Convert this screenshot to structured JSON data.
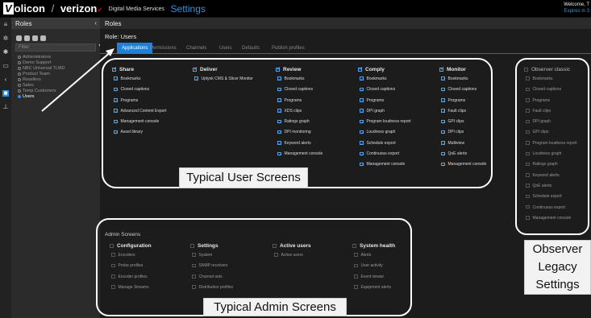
{
  "topbar": {
    "logo_prefix": "V",
    "logo_rest": "olicon",
    "partner": "verizon",
    "partner_mark": "✓",
    "dms": "Digital Media Services",
    "section": "Settings",
    "welcome": "Welcome, T",
    "expires": "Expires in 3"
  },
  "sidebar_icons": [
    "menu-icon",
    "gear-icon",
    "wrench-icon",
    "monitor-icon",
    "share-icon",
    "active-square-icon",
    "user-icon"
  ],
  "left_panel": {
    "title": "Roles",
    "collapse": "‹",
    "filter_placeholder": "Filter",
    "filter_icon": "▼",
    "items": [
      {
        "label": "Administrators",
        "selected": false
      },
      {
        "label": "Demo Support",
        "selected": false
      },
      {
        "label": "NBC Universal TLMD",
        "selected": false
      },
      {
        "label": "Product Team",
        "selected": false
      },
      {
        "label": "Resellers",
        "selected": false
      },
      {
        "label": "Sales",
        "selected": false
      },
      {
        "label": "Temp Customers",
        "selected": false
      },
      {
        "label": "Users",
        "selected": true
      }
    ]
  },
  "main": {
    "header": "Roles",
    "role_title": "Role: Users",
    "tabs": [
      "Applications",
      "Permissions",
      "Channels",
      "Users",
      "Defaults",
      "Publish profiles"
    ],
    "active_tab": 0
  },
  "user_columns": [
    {
      "title": "Share",
      "checked": true,
      "items": [
        "Bookmarks",
        "Closed captions",
        "Programs",
        "Advanced Content Export",
        "Management console",
        "Asset library"
      ]
    },
    {
      "title": "Deliver",
      "checked": true,
      "items": [
        "Uplynk CMS & Slicer Monitor"
      ]
    },
    {
      "title": "Review",
      "checked": true,
      "items": [
        "Bookmarks",
        "Closed captions",
        "Programs",
        "XDS clips",
        "Ratings graph",
        "DPI monitoring",
        "Keyword alerts",
        "Management console"
      ]
    },
    {
      "title": "Comply",
      "checked": true,
      "items": [
        "Bookmarks",
        "Closed captions",
        "Programs",
        "DPI graph",
        "Program loudness report",
        "Loudness graph",
        "Schedule export",
        "Continuous export",
        "Management console"
      ]
    },
    {
      "title": "Monitor",
      "checked": true,
      "items": [
        "Bookmarks",
        "Closed captions",
        "Programs",
        "Fault clips",
        "GPI clips",
        "DPI clips",
        "Multiview",
        "QoE alerts",
        "Management console"
      ]
    }
  ],
  "observer": {
    "title": "Observer classic",
    "items": [
      "Bookmarks",
      "Closed captions",
      "Programs",
      "Fault clips",
      "DPI graph",
      "GPI clips",
      "Program loudness report",
      "Loudness graph",
      "Ratings graph",
      "Keyword alerts",
      "QoE alerts",
      "Schedule export",
      "Continuous export",
      "Management console"
    ]
  },
  "admin": {
    "title": "Admin Screens",
    "columns": [
      {
        "title": "Configuration",
        "items": [
          "Encoders",
          "Probe profiles",
          "Encoder profiles",
          "Manage Streams"
        ]
      },
      {
        "title": "Settings",
        "items": [
          "System",
          "SNMP receivers",
          "Channel sets",
          "Distribution profiles"
        ]
      },
      {
        "title": "Active users",
        "items": [
          "Active users"
        ]
      },
      {
        "title": "System health",
        "items": [
          "Alerts",
          "User activity",
          "Event viewer",
          "Equipment alerts"
        ]
      }
    ]
  },
  "callouts": {
    "user": "Typical User Screens",
    "admin": "Typical Admin Screens",
    "observer": [
      "Observer",
      "Legacy",
      "Settings"
    ]
  },
  "colors": {
    "accent": "#1f80d8",
    "check": "#4fa4f0"
  }
}
